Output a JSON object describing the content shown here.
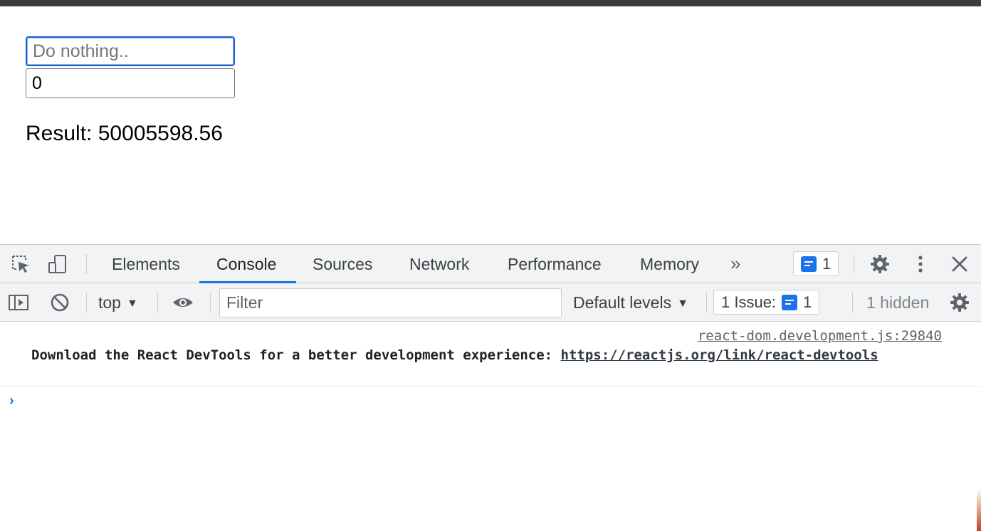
{
  "page": {
    "text_input_placeholder": "Do nothing..",
    "text_input_value": "",
    "number_input_value": "0",
    "result_label": "Result:",
    "result_value": "50005598.56"
  },
  "devtools": {
    "tabs": [
      {
        "label": "Elements",
        "active": false
      },
      {
        "label": "Console",
        "active": true
      },
      {
        "label": "Sources",
        "active": false
      },
      {
        "label": "Network",
        "active": false
      },
      {
        "label": "Performance",
        "active": false
      },
      {
        "label": "Memory",
        "active": false
      }
    ],
    "more_tabs_glyph": "»",
    "messages_badge_count": "1",
    "toolbar": {
      "context": "top",
      "filter_placeholder": "Filter",
      "filter_value": "",
      "levels": "Default levels",
      "issues_label": "1 Issue:",
      "issues_count": "1",
      "hidden_label": "1 hidden"
    },
    "console_message": {
      "source": "react-dom.development.js:29840",
      "text": "Download the React DevTools for a better development experience: ",
      "link": "https://reactjs.org/link/react-devtools"
    },
    "prompt_glyph": "›"
  },
  "colors": {
    "accent": "#1a73e8",
    "focus_border": "#1a5fd1",
    "toolbar_bg": "#f1f3f4",
    "border": "#cbcdd1"
  },
  "icons": [
    "inspect-element-icon",
    "device-toolbar-icon",
    "message-icon",
    "settings-gear-icon",
    "kebab-menu-icon",
    "close-icon",
    "sidebar-toggle-icon",
    "clear-console-icon",
    "eye-icon"
  ]
}
